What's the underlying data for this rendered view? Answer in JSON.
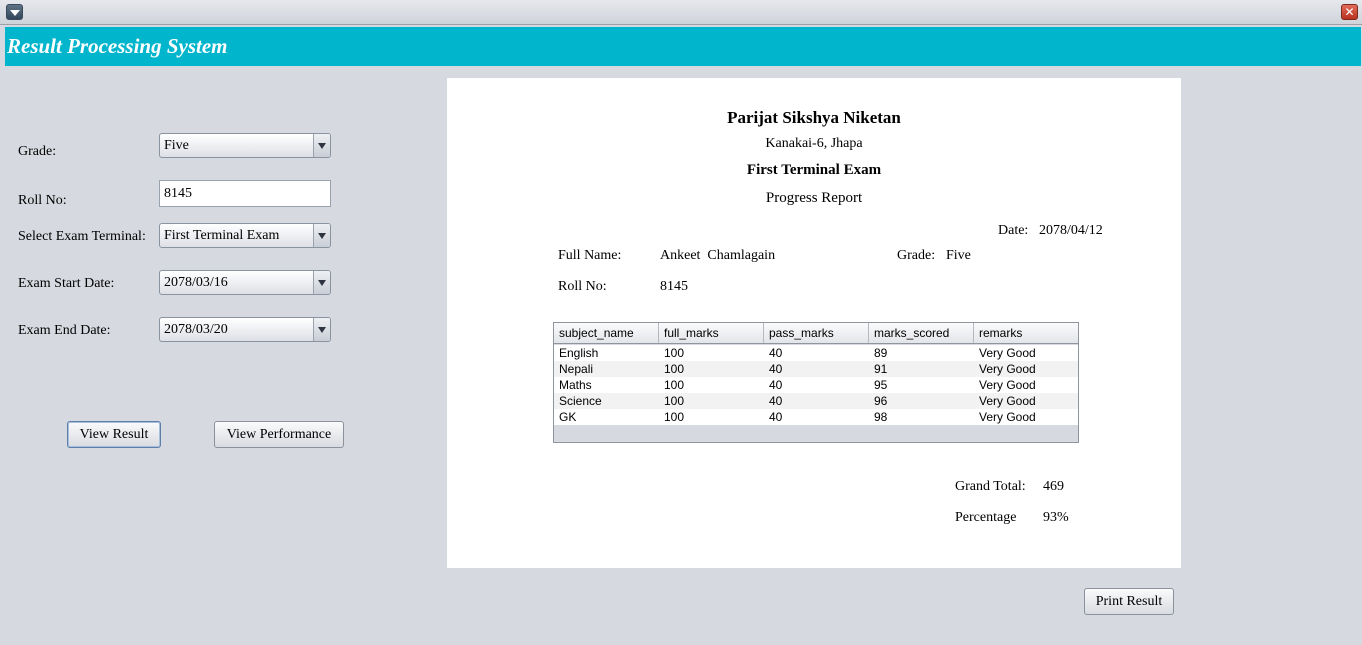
{
  "app": {
    "title": "Result Processing System"
  },
  "form": {
    "grade_label": "Grade:",
    "grade_value": "Five",
    "roll_label": "Roll No:",
    "roll_value": "8145",
    "terminal_label": "Select Exam Terminal:",
    "terminal_value": "First Terminal Exam",
    "start_label": "Exam Start Date:",
    "start_value": "2078/03/16",
    "end_label": "Exam End Date:",
    "end_value": "2078/03/20",
    "view_result": "View Result",
    "view_performance": "View Performance"
  },
  "report": {
    "school": "Parijat Sikshya Niketan",
    "address": "Kanakai-6, Jhapa",
    "exam": "First Terminal Exam",
    "heading": "Progress Report",
    "date_label": "Date:",
    "date_value": "2078/04/12",
    "name_label": "Full Name:",
    "name_value": "Ankeet  Chamlagain",
    "grade_label": "Grade:",
    "grade_value": "Five",
    "roll_label": "Roll No:",
    "roll_value": "8145",
    "table": {
      "columns": [
        "subject_name",
        "full_marks",
        "pass_marks",
        "marks_scored",
        "remarks"
      ],
      "rows": [
        [
          "English",
          "100",
          "40",
          "89",
          "Very Good"
        ],
        [
          "Nepali",
          "100",
          "40",
          "91",
          "Very Good"
        ],
        [
          "Maths",
          "100",
          "40",
          "95",
          "Very Good"
        ],
        [
          "Science",
          "100",
          "40",
          "96",
          "Very Good"
        ],
        [
          "GK",
          "100",
          "40",
          "98",
          "Very Good"
        ]
      ]
    },
    "total_label": "Grand Total:",
    "total_value": "469",
    "percentage_label": "Percentage",
    "percentage_value": "93%"
  },
  "actions": {
    "print": "Print Result"
  },
  "colors": {
    "header": "#01b5cc",
    "background": "#d6d9df",
    "report_bg": "#ffffff"
  },
  "icons": {
    "menu": "chevron-down-icon",
    "close": "close-icon"
  }
}
